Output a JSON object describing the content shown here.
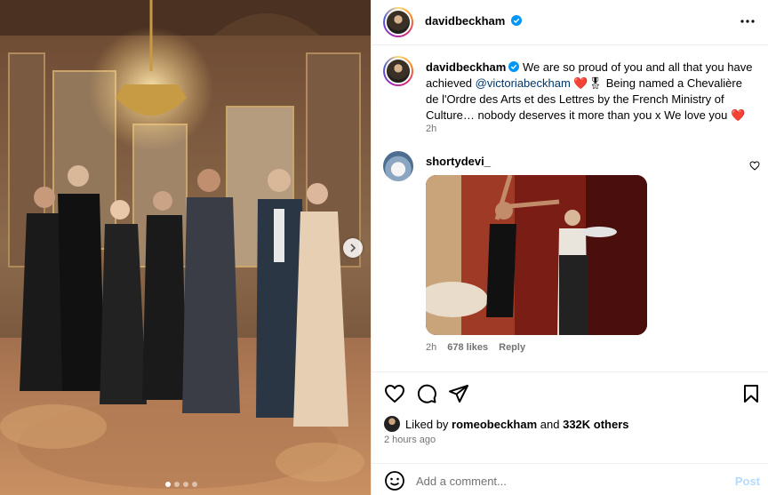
{
  "post": {
    "author": "davidbeckham",
    "caption": {
      "username": "davidbeckham",
      "text_before": "We are so proud of you and all that you have achieved",
      "mention": "@victoriabeckham",
      "text_after": "Being named a Chevalière de l'Ordre des Arts et des Lettres by the French Ministry of Culture… nobody deserves it more than you x We love you",
      "emoji_heart": "❤️",
      "emoji_medal": "🎖",
      "time": "2h"
    },
    "carousel": {
      "count": 4,
      "active_index": 0
    }
  },
  "comment": {
    "username": "shortydevi_",
    "time": "2h",
    "likes": "678 likes",
    "reply": "Reply"
  },
  "likes": {
    "prefix": "Liked by",
    "user": "romeobeckham",
    "and": "and",
    "others": "332K others"
  },
  "timestamp": "2 hours ago",
  "add_comment": {
    "placeholder": "Add a comment...",
    "post_label": "Post"
  },
  "colors": {
    "verified": "#0095f6",
    "mention": "#00376b",
    "heart": "#e0102e",
    "post_disabled": "#b3dbff",
    "meta_gray": "#737373"
  }
}
